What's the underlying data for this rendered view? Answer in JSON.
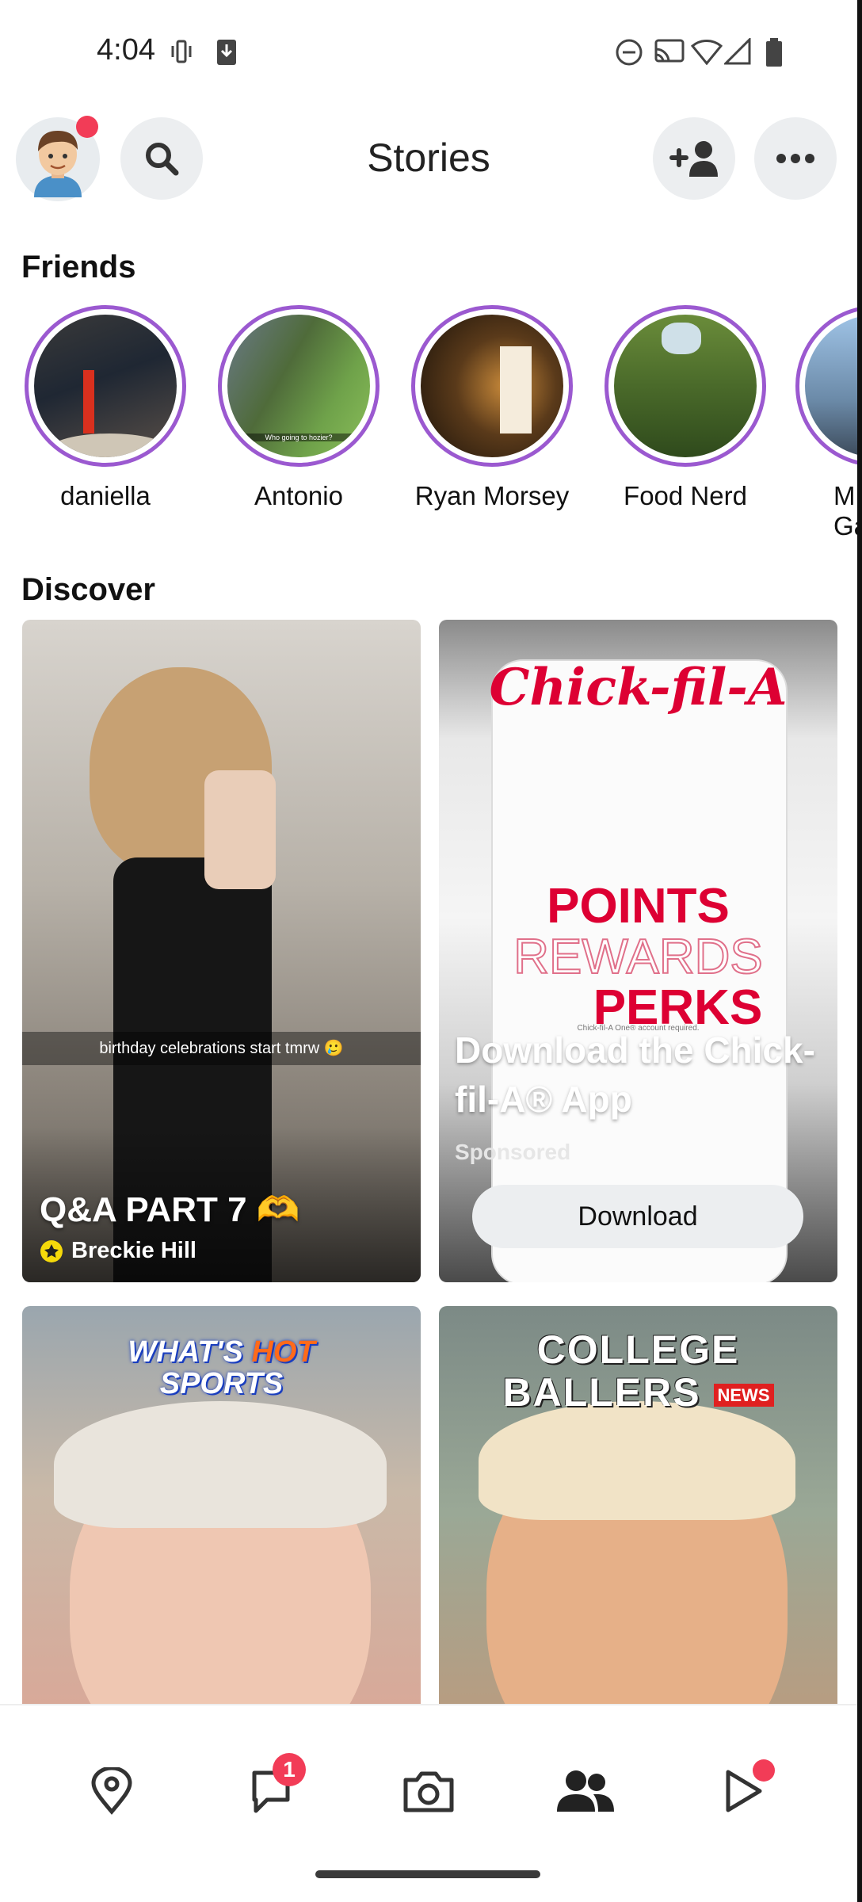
{
  "status_bar": {
    "time": "4:04"
  },
  "header": {
    "title": "Stories"
  },
  "friends": {
    "title": "Friends",
    "items": [
      {
        "name": "daniella"
      },
      {
        "name": "Antonio",
        "caption": "Who going to hozier?"
      },
      {
        "name": "Ryan Morsey"
      },
      {
        "name": "Food Nerd"
      },
      {
        "name": "M Ga"
      }
    ]
  },
  "discover": {
    "title": "Discover",
    "tiles": [
      {
        "title": "Q&A PART 7 🫶",
        "creator": "Breckie Hill",
        "caption": "birthday celebrations start tmrw 🥲"
      },
      {
        "brand": "Chick-fil-A",
        "promo_line1": "POINTS",
        "promo_line2": "REWARDS",
        "promo_line3": "PERKS",
        "fine_print": "Chick-fil-A One® account required.",
        "headline": "Download the Chick-fil-A® App",
        "sponsored": "Sponsored",
        "cta": "Download"
      },
      {
        "logo_line1": "WHAT'S",
        "logo_hot": "HOT",
        "logo_line2": "SPORTS"
      },
      {
        "logo_line1": "COLLEGE",
        "logo_line2": "BALLERS",
        "logo_news": "NEWS"
      }
    ]
  },
  "bottom_nav": {
    "chat_badge": "1",
    "items": [
      "map-icon",
      "chat-icon",
      "camera-icon",
      "friends-icon",
      "spotlight-icon"
    ]
  },
  "colors": {
    "story_ring": "#9b59d0",
    "badge": "#f23c57",
    "chickfila_red": "#dd0033",
    "button_bg": "#eceef0"
  }
}
